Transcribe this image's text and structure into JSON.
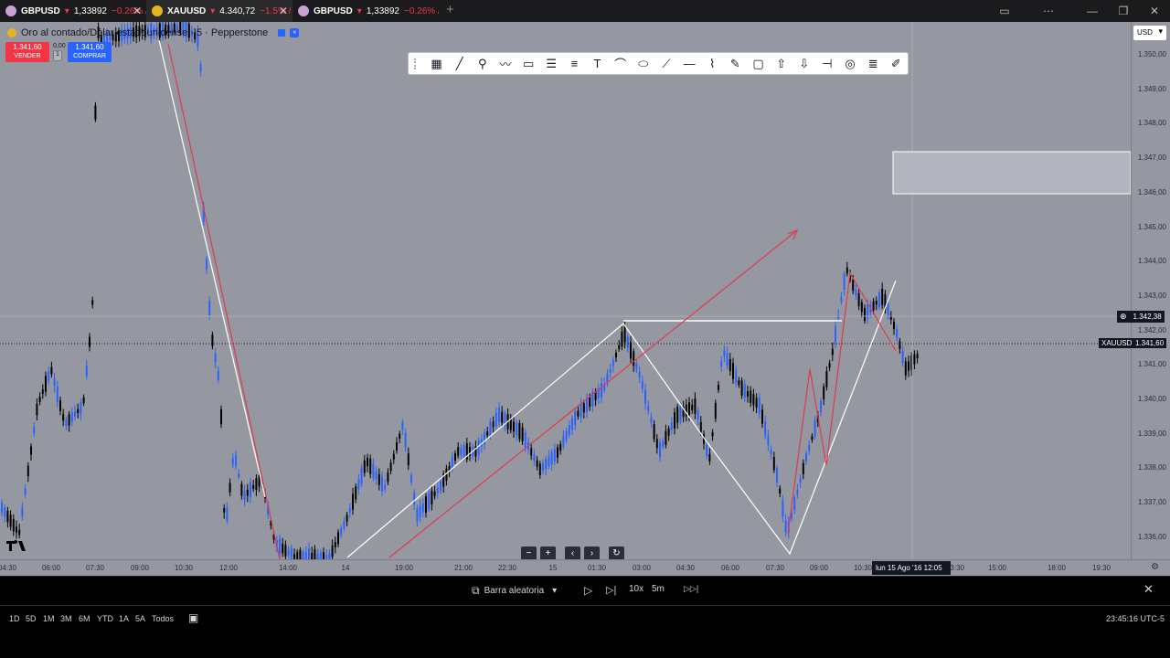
{
  "tabs": [
    {
      "symbol": "GBPUSD",
      "price": "1,33892",
      "change": "−0.26% /",
      "active": false,
      "icon_color": "#c9a0d6"
    },
    {
      "symbol": "XAUUSD",
      "price": "4.340,72",
      "change": "−1.5% /",
      "active": true,
      "icon_color": "#e6b422"
    },
    {
      "symbol": "GBPUSD",
      "price": "1,33892",
      "change": "−0.26% /",
      "active": false,
      "icon_color": "#c9a0d6"
    }
  ],
  "new_tab_label": "+",
  "window_controls": [
    "▭",
    "⋯",
    "—",
    "❐",
    "✕"
  ],
  "header": {
    "symbol_name": "Oro al contado/Dólar estadounidense · 5 · Pepperstone",
    "sell_price": "1.341,60",
    "sell_label": "VENDER",
    "spread": "0,00",
    "spread_box": "1",
    "buy_price": "1.341,60",
    "buy_label": "COMPRAR"
  },
  "drawing_toolbar": {
    "icons": [
      "grid-icon",
      "trendline-icon",
      "pitchfork-icon",
      "pattern-icon",
      "rectangle-icon",
      "parallel-channel-icon",
      "fib-icon",
      "text-icon",
      "arc-icon",
      "ellipse-icon",
      "path-icon",
      "horizontal-ray-icon",
      "xabcd-icon",
      "brush-icon",
      "callout-icon",
      "arrow-up-icon",
      "arrow-down-icon",
      "cross-line-icon",
      "target-icon",
      "lines-icon",
      "pencil-icon"
    ],
    "glyphs": [
      "▦",
      "╱",
      "⚲",
      "〰",
      "▭",
      "☰",
      "≡",
      "T",
      "⌒",
      "⬭",
      "⟋",
      "—",
      "⌇",
      "✎",
      "▢",
      "⇧",
      "⇩",
      "⊣",
      "◎",
      "≣",
      "✐"
    ]
  },
  "price_axis": {
    "currency_button": "USD",
    "ticks": [
      "1.350,00",
      "1.349,00",
      "1.348,00",
      "1.347,00",
      "1.346,00",
      "1.345,00",
      "1.344,00",
      "1.343,00",
      "1.342,00",
      "1.341,00",
      "1.340,00",
      "1.339,00",
      "1.338,00",
      "1.337,00",
      "1.336,00"
    ],
    "crosshair_price": "1.342,38",
    "current_symbol": "XAUUSD",
    "current_price": "1.341,60"
  },
  "time_axis": {
    "labels": [
      "04:30",
      "06:00",
      "07:30",
      "09:00",
      "10:30",
      "12:00",
      "14:00",
      "14",
      "19:00",
      "21:00",
      "22:30",
      "15",
      "01:30",
      "03:00",
      "04:30",
      "06:00",
      "07:30",
      "09:00",
      "10:30",
      "13:30",
      "15:00",
      "18:00",
      "19:30"
    ],
    "crosshair_time": "lun 15 Ago '16   12:05"
  },
  "replay_mini": [
    "−",
    "+",
    "‹",
    "›",
    "↻"
  ],
  "replay_bar": {
    "random_bar_label": "Barra aleatoria",
    "speed": "10x",
    "interval": "5m",
    "play": "▷",
    "step": "▷|",
    "jump": "▷▷|",
    "close": "✕"
  },
  "ranges": [
    "1D",
    "5D",
    "1M",
    "3M",
    "6M",
    "YTD",
    "1A",
    "5A",
    "Todos"
  ],
  "clock": "23:45:16 UTC-5",
  "colors": {
    "chart_bg": "#9598a1",
    "candle_up": "#2962ff",
    "candle_down": "#000000",
    "drawing_red": "#e03a50",
    "drawing_white": "#ffffff"
  }
}
